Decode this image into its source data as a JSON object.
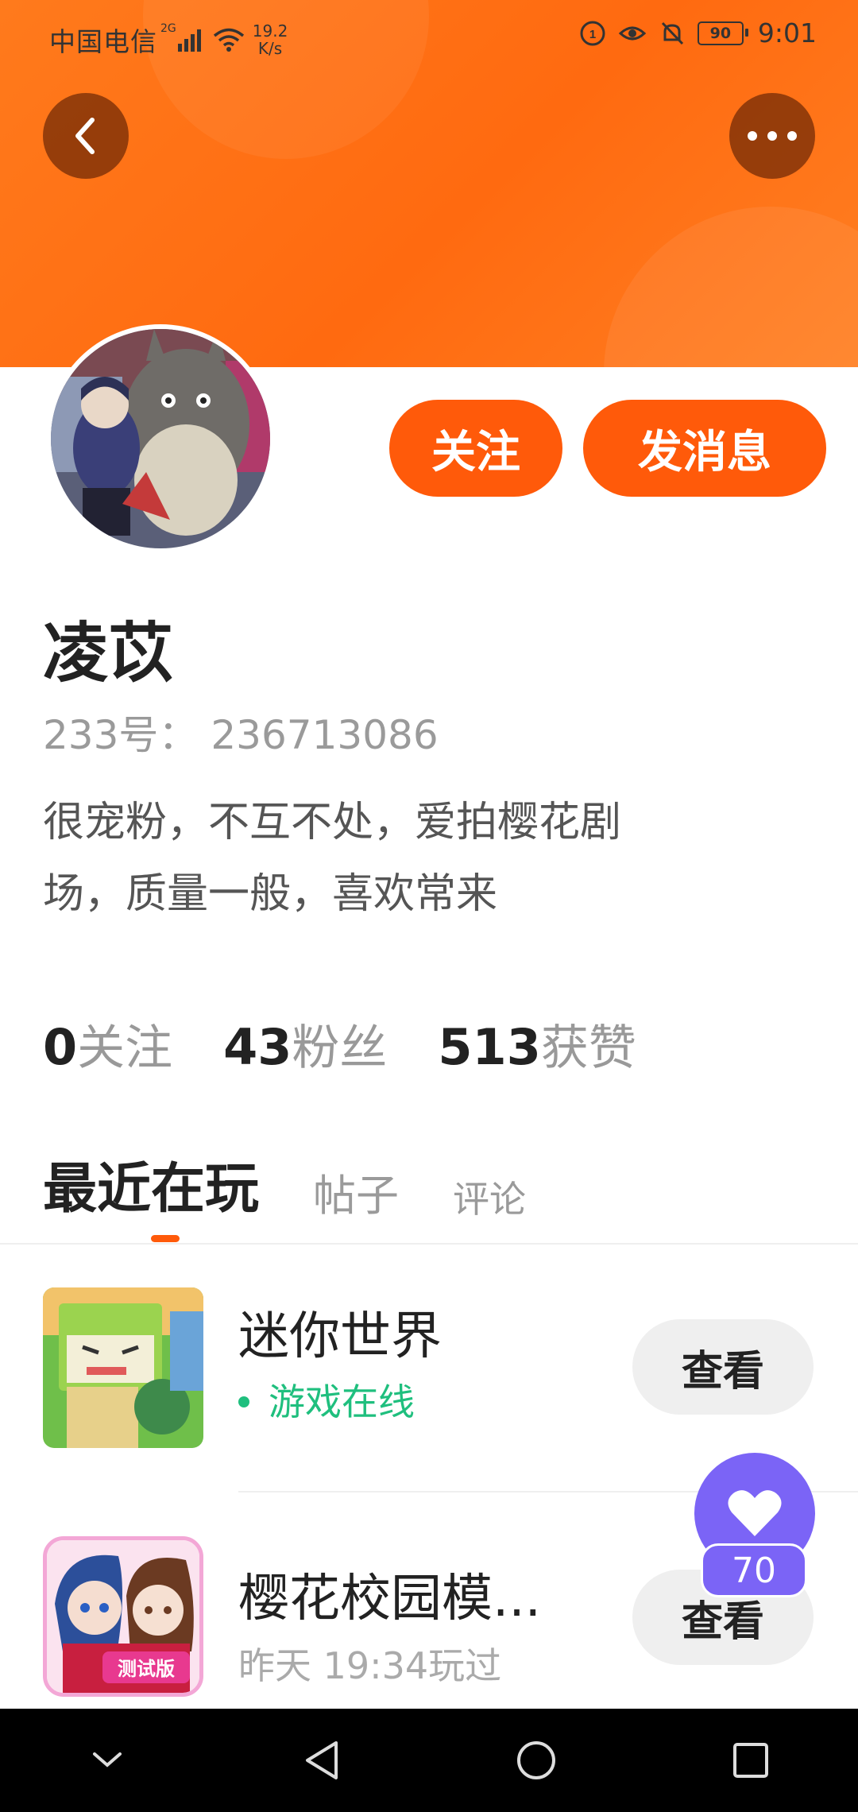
{
  "status_bar": {
    "carrier": "中国电信",
    "network_label": "2G",
    "speed_value": "19.2",
    "speed_unit": "K/s",
    "battery": "90",
    "time": "9:01"
  },
  "header": {
    "back_icon": "chevron-left-icon",
    "more_icon": "more-dots-icon"
  },
  "profile": {
    "follow_label": "关注",
    "message_label": "发消息",
    "username": "凌苡",
    "user_id": "233号：  236713086",
    "bio_line1": "很宠粉，不互不处，爱拍樱花剧",
    "bio_line2": "场，质量一般，喜欢常来"
  },
  "stats": [
    {
      "value": "0",
      "label": "关注"
    },
    {
      "value": "43",
      "label": "粉丝"
    },
    {
      "value": "513",
      "label": "获赞"
    }
  ],
  "tabs": [
    {
      "label": "最近在玩",
      "active": true
    },
    {
      "label": "帖子",
      "active": false
    },
    {
      "label": "评论",
      "active": false
    }
  ],
  "games": [
    {
      "title": "迷你世界",
      "status": "游戏在线",
      "status_type": "online",
      "button": "查看"
    },
    {
      "title": "樱花校园模...",
      "status": "昨天 19:34玩过",
      "status_type": "past",
      "button": "查看",
      "icon_badge": "测试版"
    }
  ],
  "like_fab": {
    "count": "70",
    "icon": "heart-icon"
  },
  "colors": {
    "accent": "#ff5a0a",
    "online": "#1fbf7e",
    "fab": "#7b64f6"
  }
}
